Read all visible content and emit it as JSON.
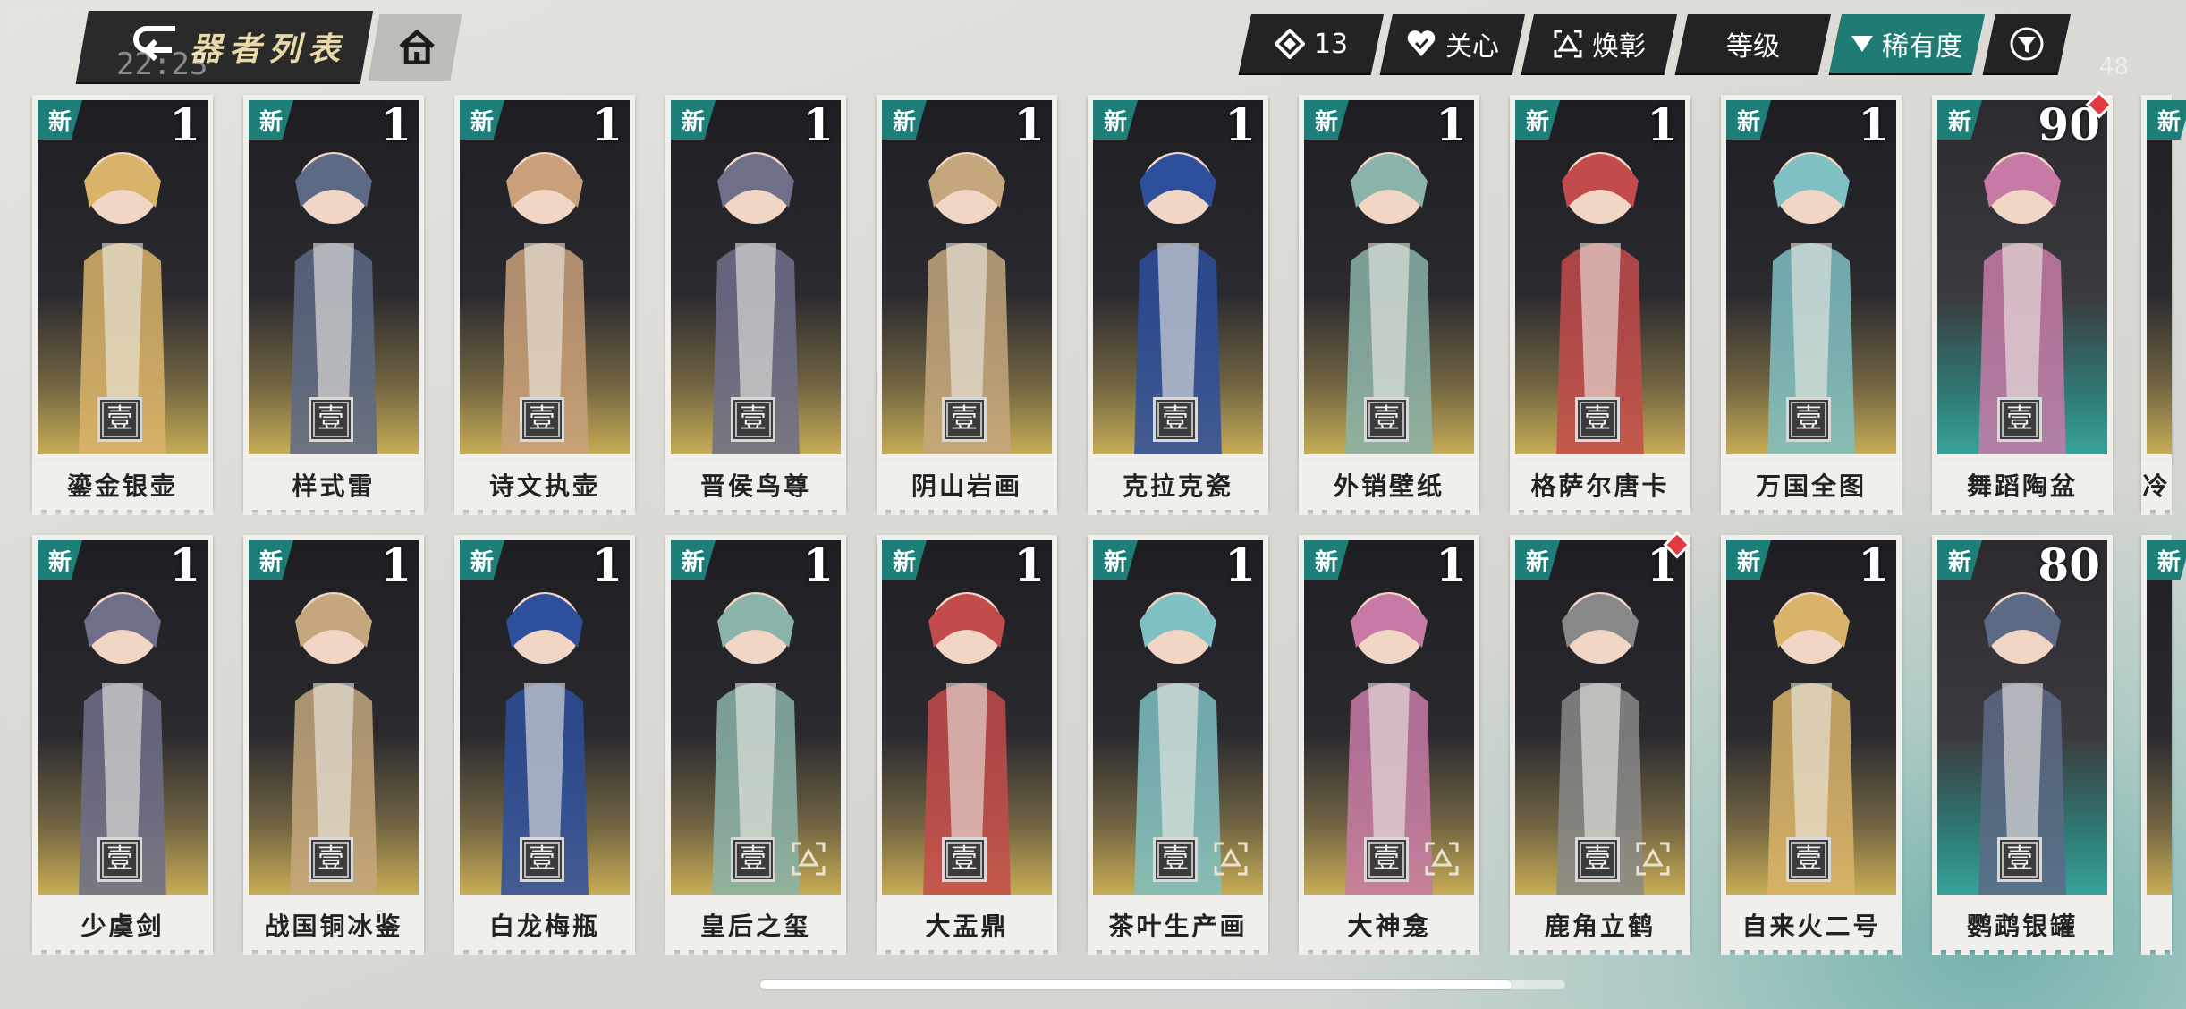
{
  "header": {
    "title": "器者列表",
    "clock": "22:23",
    "status_right": "48"
  },
  "toolbar": {
    "count": "13",
    "favorite_label": "关心",
    "awaken_label": "焕彰",
    "level_label": "等级",
    "rarity_label": "稀有度",
    "filter_icon": "filter-icon"
  },
  "colors": {
    "accent": "#1f7b74",
    "button_dark": "#232323",
    "name_color": "#222222"
  },
  "cards_row1": [
    {
      "name": "鎏金银壶",
      "level": "1",
      "rank": "壹",
      "new": "新"
    },
    {
      "name": "样式雷",
      "level": "1",
      "rank": "壹",
      "new": "新"
    },
    {
      "name": "诗文执壶",
      "level": "1",
      "rank": "壹",
      "new": "新"
    },
    {
      "name": "晋侯鸟尊",
      "level": "1",
      "rank": "壹",
      "new": "新"
    },
    {
      "name": "阴山岩画",
      "level": "1",
      "rank": "壹",
      "new": "新"
    },
    {
      "name": "克拉克瓷",
      "level": "1",
      "rank": "壹",
      "new": "新"
    },
    {
      "name": "外销壁纸",
      "level": "1",
      "rank": "壹",
      "new": "新"
    },
    {
      "name": "格萨尔唐卡",
      "level": "1",
      "rank": "壹",
      "new": "新"
    },
    {
      "name": "万国全图",
      "level": "1",
      "rank": "壹",
      "new": "新"
    },
    {
      "name": "舞蹈陶盆",
      "level": "90",
      "rank": "壹",
      "new": "新"
    },
    {
      "name": "冷",
      "level": "",
      "rank": "",
      "new": "新"
    }
  ],
  "cards_row2": [
    {
      "name": "少虞剑",
      "level": "1",
      "rank": "壹",
      "new": "新"
    },
    {
      "name": "战国铜冰鉴",
      "level": "1",
      "rank": "壹",
      "new": "新"
    },
    {
      "name": "白龙梅瓶",
      "level": "1",
      "rank": "壹",
      "new": "新"
    },
    {
      "name": "皇后之玺",
      "level": "1",
      "rank": "壹",
      "new": "新"
    },
    {
      "name": "大盂鼎",
      "level": "1",
      "rank": "壹",
      "new": "新"
    },
    {
      "name": "茶叶生产画",
      "level": "1",
      "rank": "壹",
      "new": "新"
    },
    {
      "name": "大神龛",
      "level": "1",
      "rank": "壹",
      "new": "新"
    },
    {
      "name": "鹿角立鹤",
      "level": "1",
      "rank": "壹",
      "new": "新"
    },
    {
      "name": "自来火二号",
      "level": "1",
      "rank": "壹",
      "new": "新"
    },
    {
      "name": "鹦鹉银罐",
      "level": "80",
      "rank": "壹",
      "new": "新"
    },
    {
      "name": "",
      "level": "",
      "rank": "",
      "new": "新"
    }
  ],
  "scroll": {
    "position_fraction": 0.0
  }
}
